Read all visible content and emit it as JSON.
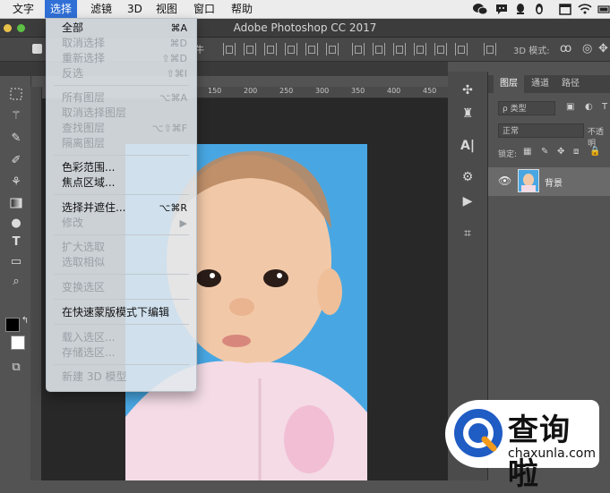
{
  "menubar": {
    "items": [
      "文字",
      "选择",
      "滤镜",
      "3D",
      "视图",
      "窗口",
      "帮助"
    ],
    "active_index": 1,
    "status_icons": [
      "wechat-icon",
      "chat-bubble-icon",
      "qq-icon",
      "penguin-icon",
      "calendar-icon",
      "wifi-icon",
      "battery-icon"
    ]
  },
  "window": {
    "title": "Adobe Photoshop CC 2017"
  },
  "options_bar": {
    "truncated_label": "牛",
    "mode_label": "3D 模式:"
  },
  "ruler": {
    "ticks": [
      "150",
      "200",
      "250",
      "300",
      "350",
      "400",
      "450"
    ]
  },
  "select_menu": {
    "items": [
      {
        "label": "全部",
        "shortcut": "⌘A",
        "enabled": true
      },
      {
        "label": "取消选择",
        "shortcut": "⌘D",
        "enabled": false
      },
      {
        "label": "重新选择",
        "shortcut": "⇧⌘D",
        "enabled": false
      },
      {
        "label": "反选",
        "shortcut": "⇧⌘I",
        "enabled": false
      },
      {
        "label": "所有图层",
        "shortcut": "⌥⌘A",
        "enabled": false
      },
      {
        "label": "取消选择图层",
        "shortcut": "",
        "enabled": false
      },
      {
        "label": "查找图层",
        "shortcut": "⌥⇧⌘F",
        "enabled": false
      },
      {
        "label": "隔离图层",
        "shortcut": "",
        "enabled": false
      },
      {
        "label": "色彩范围...",
        "shortcut": "",
        "enabled": true
      },
      {
        "label": "焦点区域...",
        "shortcut": "",
        "enabled": true
      },
      {
        "label": "选择并遮住...",
        "shortcut": "⌥⌘R",
        "enabled": true
      },
      {
        "label": "修改",
        "shortcut": "▶",
        "enabled": false
      },
      {
        "label": "扩大选取",
        "shortcut": "",
        "enabled": false
      },
      {
        "label": "选取相似",
        "shortcut": "",
        "enabled": false
      },
      {
        "label": "变换选区",
        "shortcut": "",
        "enabled": false
      },
      {
        "label": "在快速蒙版模式下编辑",
        "shortcut": "",
        "enabled": true
      },
      {
        "label": "载入选区...",
        "shortcut": "",
        "enabled": false
      },
      {
        "label": "存储选区...",
        "shortcut": "",
        "enabled": false
      },
      {
        "label": "新建 3D 模型",
        "shortcut": "",
        "enabled": false
      }
    ]
  },
  "layers_panel": {
    "tabs": [
      "图层",
      "通道",
      "路径"
    ],
    "active_tab": 0,
    "filter_label": "ρ 类型",
    "blend_mode": "正常",
    "opacity_label": "不透明",
    "lock_label": "锁定:",
    "layers": [
      {
        "name": "背景",
        "visible": true
      }
    ]
  },
  "watermark": {
    "cn": "查询啦",
    "en": "chaxunla.com"
  },
  "colors": {
    "menu_highlight": "#2f6fd6",
    "photo_background": "#48a7e3",
    "ps_panel": "#535353"
  }
}
